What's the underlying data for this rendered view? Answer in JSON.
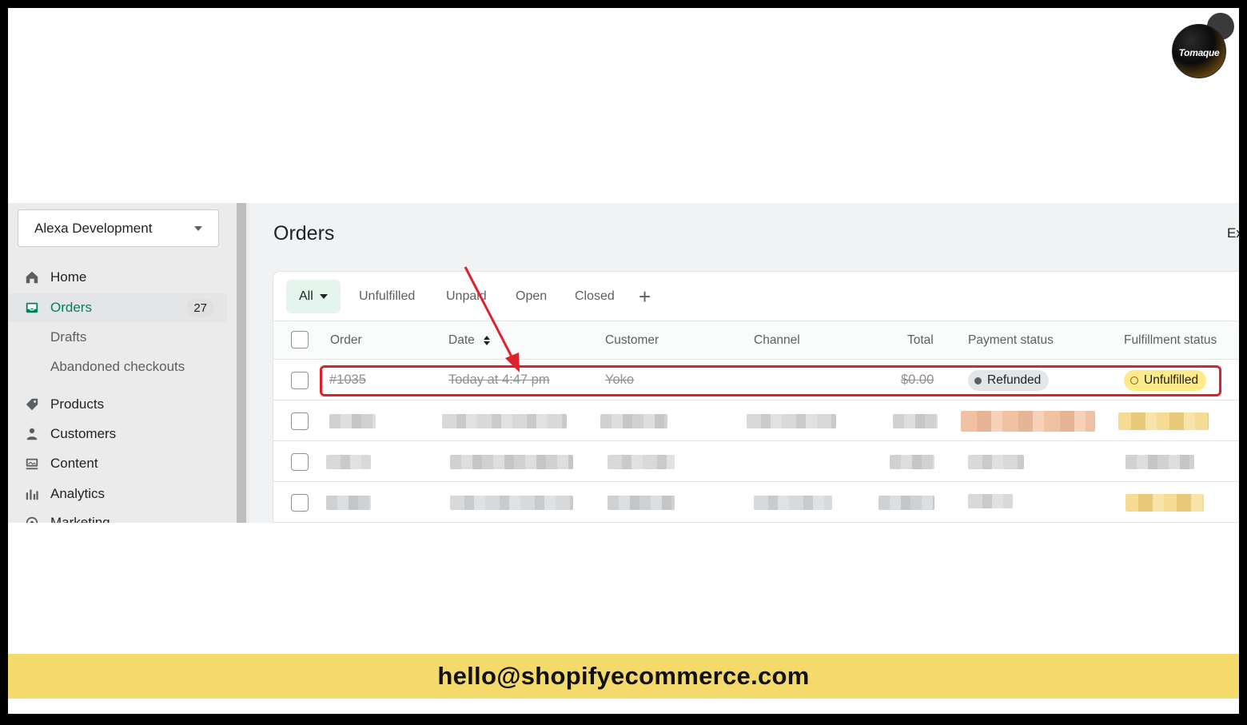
{
  "logo": {
    "text": "Tomaque"
  },
  "sidebar": {
    "store_name": "Alexa Development",
    "items": [
      {
        "label": "Home",
        "icon": "home-icon"
      },
      {
        "label": "Orders",
        "icon": "orders-inbox-icon",
        "badge": "27",
        "active": true
      },
      {
        "label": "Drafts",
        "sub": true
      },
      {
        "label": "Abandoned checkouts",
        "sub": true
      },
      {
        "label": "Products",
        "icon": "tag-icon"
      },
      {
        "label": "Customers",
        "icon": "person-icon"
      },
      {
        "label": "Content",
        "icon": "content-icon"
      },
      {
        "label": "Analytics",
        "icon": "bar-chart-icon"
      },
      {
        "label": "Marketing",
        "icon": "target-icon"
      }
    ]
  },
  "main": {
    "title": "Orders",
    "export_label_cut": "Ex",
    "tabs": [
      "All",
      "Unfulfilled",
      "Unpaid",
      "Open",
      "Closed",
      "+"
    ],
    "columns": [
      "Order",
      "Date",
      "Customer",
      "Channel",
      "Total",
      "Payment status",
      "Fulfillment status"
    ],
    "highlighted_row": {
      "order": "#1035",
      "date": "Today at 4:47 pm",
      "customer": "Yoko",
      "channel": "",
      "total": "$0.00",
      "payment_status": "Refunded",
      "fulfillment_status": "Unfulfilled"
    }
  },
  "colors": {
    "accent": "#008060",
    "highlight_border": "#e0202a",
    "email_bar": "#f4d96b"
  },
  "footer": {
    "email": "hello@shopifyecommerce.com"
  }
}
